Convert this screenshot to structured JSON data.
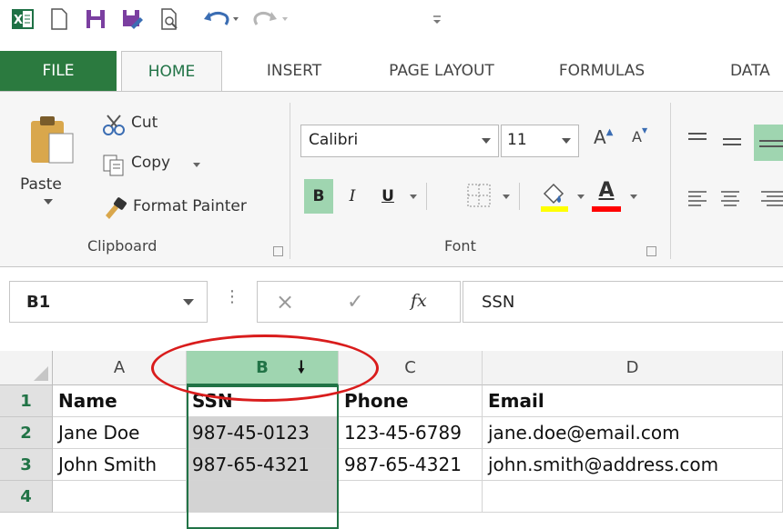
{
  "quick_access": {
    "items": [
      "excel-logo",
      "new-document",
      "save",
      "save-as",
      "print-preview",
      "undo",
      "redo",
      "customize"
    ]
  },
  "tabs": [
    {
      "label": "FILE"
    },
    {
      "label": "HOME"
    },
    {
      "label": "INSERT"
    },
    {
      "label": "PAGE LAYOUT"
    },
    {
      "label": "FORMULAS"
    },
    {
      "label": "DATA"
    }
  ],
  "clipboard": {
    "paste_label": "Paste",
    "cut_label": "Cut",
    "copy_label": "Copy",
    "format_painter_label": "Format Painter",
    "group_label": "Clipboard"
  },
  "font": {
    "font_name": "Calibri",
    "font_size": "11",
    "bold_label": "B",
    "italic_label": "I",
    "underline_label": "U",
    "grow_label": "A",
    "shrink_label": "A",
    "font_color_label": "A",
    "group_label": "Font",
    "highlight_color": "#ffff00",
    "font_color": "#ff0000"
  },
  "formula_bar": {
    "name_box": "B1",
    "cancel_icon": "×",
    "enter_icon": "✓",
    "fx_label": "fx",
    "content": "SSN"
  },
  "sheet": {
    "columns": [
      "A",
      "B",
      "C",
      "D"
    ],
    "selected_column": "B",
    "row_numbers": [
      "1",
      "2",
      "3",
      "4"
    ],
    "rows": [
      [
        "Name",
        "SSN",
        "Phone",
        "Email"
      ],
      [
        "Jane Doe",
        "987-45-0123",
        "123-45-6789",
        "jane.doe@email.com"
      ],
      [
        "John Smith",
        "987-65-4321",
        "987-65-4321",
        "john.smith@address.com"
      ],
      [
        "",
        "",
        "",
        ""
      ]
    ]
  },
  "colors": {
    "accent": "#217346",
    "selection_fill": "#9fd5b0",
    "annotation": "#d91c1c"
  }
}
